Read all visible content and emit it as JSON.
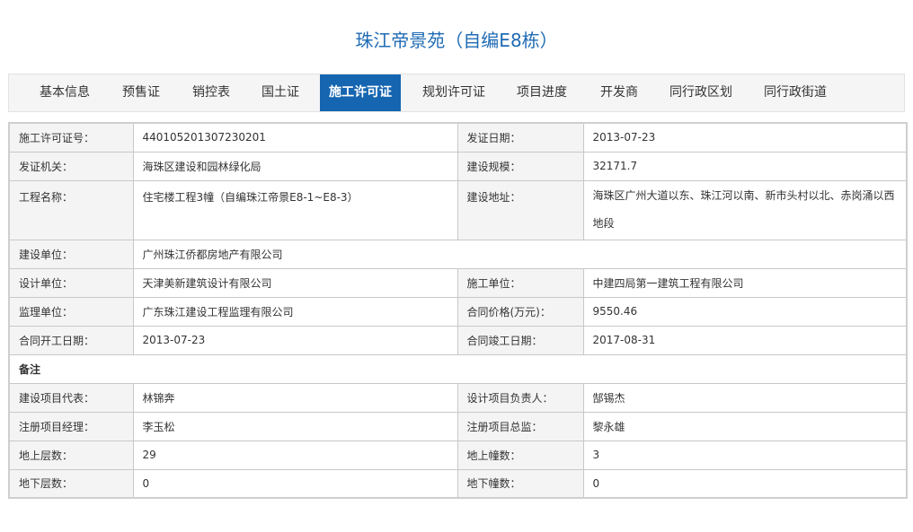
{
  "page": {
    "title": "珠江帝景苑（自编E8栋）"
  },
  "tabs": [
    {
      "label": "基本信息"
    },
    {
      "label": "预售证"
    },
    {
      "label": "销控表"
    },
    {
      "label": "国土证"
    },
    {
      "label": "施工许可证",
      "active": true
    },
    {
      "label": "规划许可证"
    },
    {
      "label": "项目进度"
    },
    {
      "label": "开发商"
    },
    {
      "label": "同行政区划"
    },
    {
      "label": "同行政街道"
    }
  ],
  "permit": {
    "permit_no_label": "施工许可证号：",
    "permit_no": "440105201307230201",
    "issue_date_label": "发证日期：",
    "issue_date": "2013-07-23",
    "issuer_label": "发证机关：",
    "issuer": "海珠区建设和园林绿化局",
    "scale_label": "建设规模：",
    "scale": "32171.7",
    "project_name_label": "工程名称：",
    "project_name": "住宅楼工程3幢（自编珠江帝景E8-1~E8-3）",
    "address_label": "建设地址：",
    "address": "海珠区广州大道以东、珠江河以南、新市头村以北、赤岗涌以西地段",
    "builder_label": "建设单位：",
    "builder": "广州珠江侨都房地产有限公司",
    "designer_label": "设计单位：",
    "designer": "天津美新建筑设计有限公司",
    "contractor_label": "施工单位：",
    "contractor": "中建四局第一建筑工程有限公司",
    "supervisor_label": "监理单位：",
    "supervisor": "广东珠江建设工程监理有限公司",
    "contract_price_label": "合同价格(万元)：",
    "contract_price": "9550.46",
    "start_date_label": "合同开工日期：",
    "start_date": "2013-07-23",
    "end_date_label": "合同竣工日期：",
    "end_date": "2017-08-31",
    "remark_label": "备注",
    "builder_rep_label": "建设项目代表：",
    "builder_rep": "林锦奔",
    "design_lead_label": "设计项目负责人：",
    "design_lead": "郜锡杰",
    "pm_label": "注册项目经理：",
    "pm": "李玉松",
    "chief_supervisor_label": "注册项目总监：",
    "chief_supervisor": "黎永雄",
    "floors_above_label": "地上层数：",
    "floors_above": "29",
    "buildings_above_label": "地上幢数：",
    "buildings_above": "3",
    "floors_below_label": "地下层数：",
    "floors_below": "0",
    "buildings_below_label": "地下幢数：",
    "buildings_below": "0"
  }
}
